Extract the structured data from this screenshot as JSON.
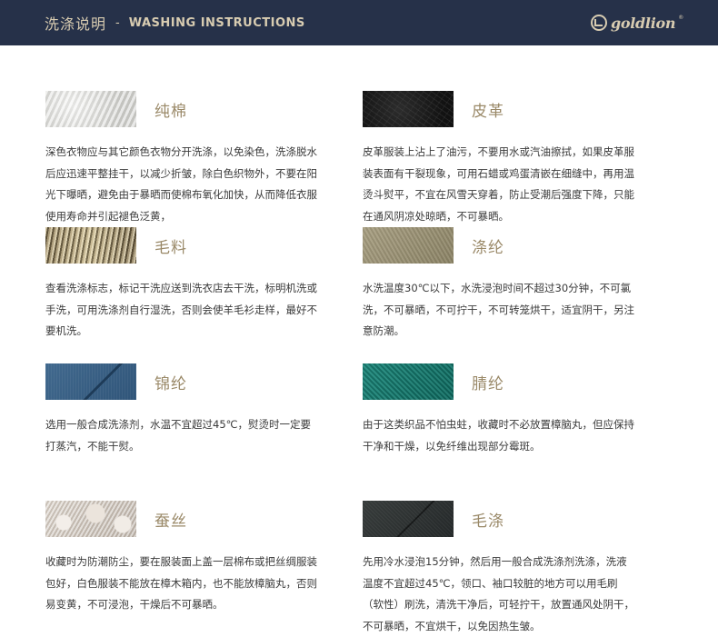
{
  "header": {
    "title_cn": "洗涤说明",
    "separator": "-",
    "title_en": "WASHING INSTRUCTIONS",
    "brand": "goldlion",
    "brand_reg": "®",
    "background": "#263149",
    "accent": "#d8ccb1"
  },
  "items": [
    {
      "name": "纯棉",
      "texture": "cotton-swatch",
      "desc": "深色衣物应与其它颜色衣物分开洗涤，以免染色，洗涤脱水后应迅速平整挂干，以减少折皱，除白色织物外，不要在阳光下曝晒，避免由于暴晒而使棉布氧化加快，从而降低衣服使用寿命并引起褪色泛黄，"
    },
    {
      "name": "皮革",
      "texture": "leather-swatch",
      "desc": "皮革服装上沾上了油污，不要用水或汽油擦拭，如果皮革服装表面有干裂现象，可用石蜡或鸡蛋清嵌在细缝中，再用温烫斗熨平，不宜在风雪天穿着，防止受潮后强度下降，只能在通风阴凉处晾晒，不可暴晒。"
    },
    {
      "name": "毛料",
      "texture": "wool-swatch",
      "desc": "查看洗涤标志，标记干洗应送到洗衣店去干洗，标明机洗或手洗，可用洗涤剂自行湿洗，否则会使羊毛衫走样，最好不要机洗。"
    },
    {
      "name": "涤纶",
      "texture": "polyester-swatch",
      "desc": "水洗温度30℃以下，水洗浸泡时间不超过30分钟，不可氯洗，不可暴晒，不可拧干，不可转笼烘干，适宜阴干，另注意防潮。"
    },
    {
      "name": "锦纶",
      "texture": "nylon-swatch",
      "desc": "选用一般合成洗涤剂，水温不宜超过45℃，熨烫时一定要打蒸汽，不能干熨。"
    },
    {
      "name": "腈纶",
      "texture": "acrylic-swatch",
      "desc": "由于这类织品不怕虫蛀，收藏时不必放置樟脑丸，但应保持干净和干燥，以免纤维出现部分霉斑。"
    },
    {
      "name": "蚕丝",
      "texture": "silk-swatch",
      "desc": "收藏时为防潮防尘，要在服装面上盖一层棉布或把丝绸服装包好，白色服装不能放在樟木箱内，也不能放樟脑丸，否则易变黄，不可浸泡，干燥后不可暴晒。"
    },
    {
      "name": "毛涤",
      "texture": "wool-polyester-swatch",
      "desc": "先用冷水浸泡15分钟，然后用一般合成洗涤剂洗涤，洗液温度不宜超过45℃，领口、袖口较脏的地方可以用毛刷（软性）刷洗，清洗干净后，可轻拧干，放置通风处阴干，不可暴晒，不宜烘干，以免因热生皱。"
    }
  ]
}
